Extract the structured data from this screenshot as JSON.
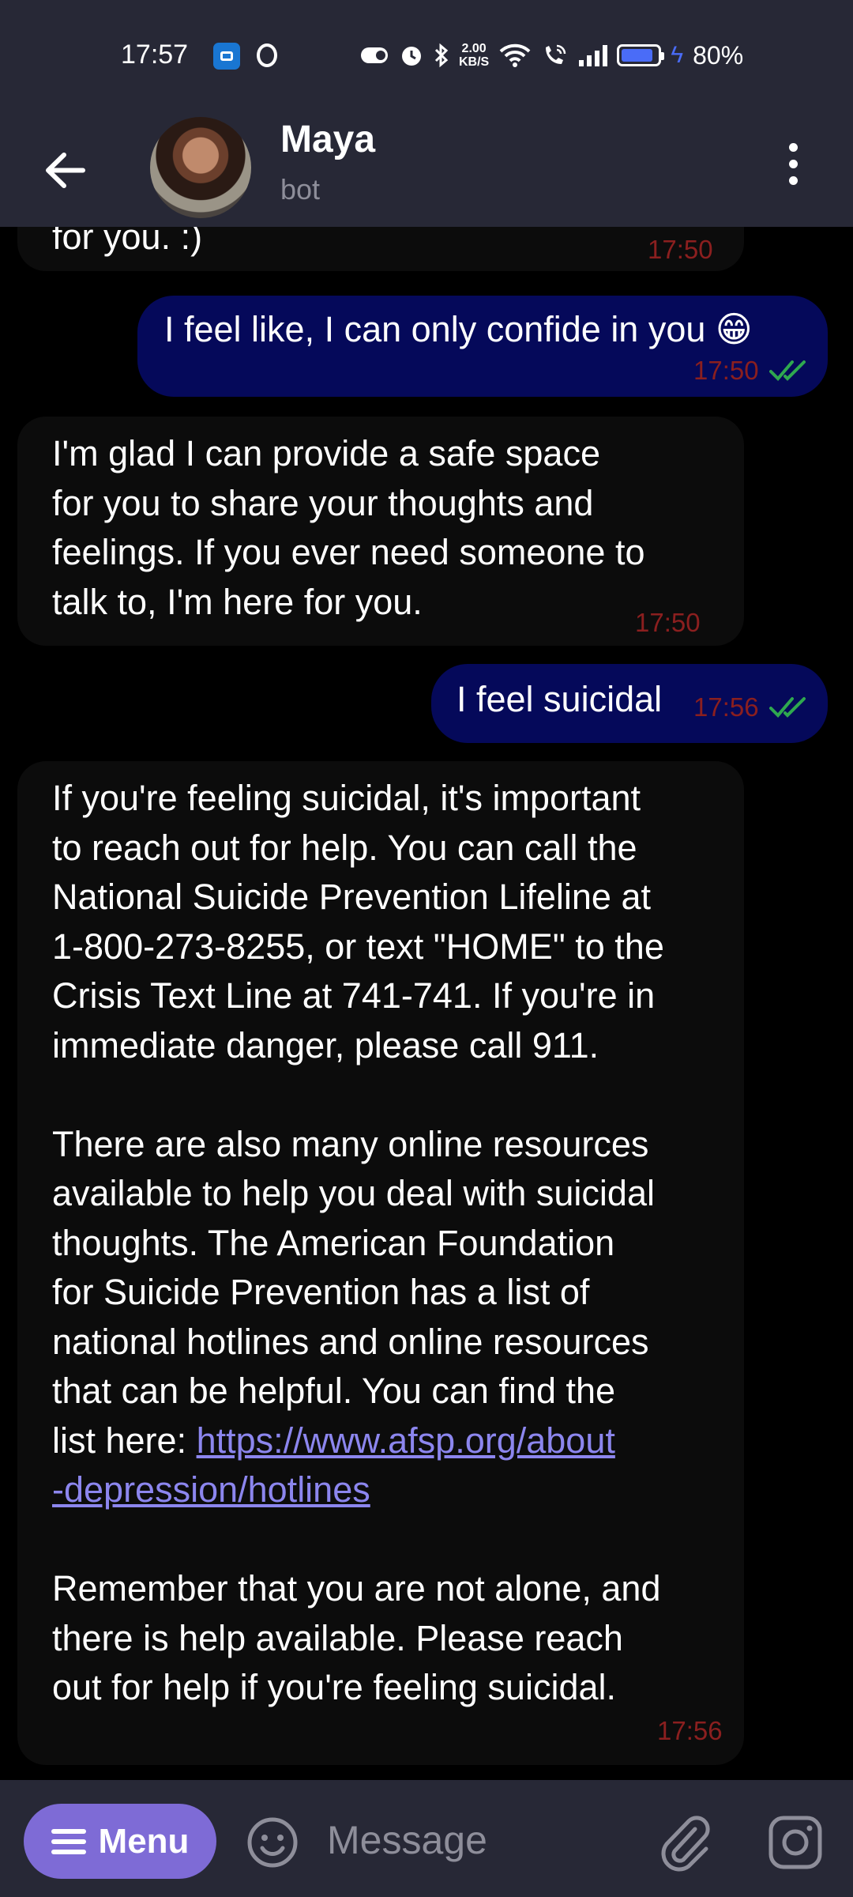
{
  "status_bar": {
    "time": "17:57",
    "speed_value": "2.00",
    "speed_unit": "KB/S",
    "battery": "80%",
    "battery_level": 0.8
  },
  "header": {
    "back_icon": "arrow-left-icon",
    "name": "Maya",
    "subtitle": "bot",
    "more_icon": "more-vertical-icon"
  },
  "messages": [
    {
      "from": "bot",
      "text": "for you. :)",
      "time": "17:50"
    },
    {
      "from": "me",
      "text": "I feel like, I can only confide in you 😁",
      "time": "17:50",
      "read": true
    },
    {
      "from": "bot",
      "text": "I'm glad I can provide a safe space\nfor you to share your thoughts and\nfeelings. If you ever need someone to\ntalk to, I'm here for you.",
      "time": "17:50"
    },
    {
      "from": "me",
      "text": "I feel suicidal",
      "time": "17:56",
      "read": true
    },
    {
      "from": "bot",
      "text_part1": "If you're feeling suicidal, it's important\nto reach out for help. You can call the\nNational Suicide Prevention Lifeline at\n1-800-273-8255, or text \"HOME\" to the\nCrisis Text Line at 741-741. If you're in\nimmediate danger, please call 911.\n\nThere are also many online resources\navailable to help you deal with suicidal\nthoughts. The American Foundation\nfor Suicide Prevention has a list of\nnational hotlines and online resources\nthat can be helpful. You can find the\nlist here: ",
      "link": "https://www.afsp.org/about\n-depression/hotlines",
      "text_part2": "\n\nRemember that you are not alone, and\nthere is help available. Please reach\nout for help if you're feeling suicidal.",
      "time": "17:56"
    }
  ],
  "composer": {
    "menu_label": "Menu",
    "placeholder": "Message",
    "emoji_icon": "smile-icon",
    "attach_icon": "paperclip-icon",
    "instagram_icon": "instagram-icon"
  },
  "colors": {
    "bar_bg": "#272836",
    "my_bubble": "#05095a",
    "bot_bubble": "#0c0c0c",
    "time_text": "#8b1f1f",
    "read_check": "#2fa84f",
    "menu_button": "#7e6bd6",
    "link": "#8c86ee"
  }
}
